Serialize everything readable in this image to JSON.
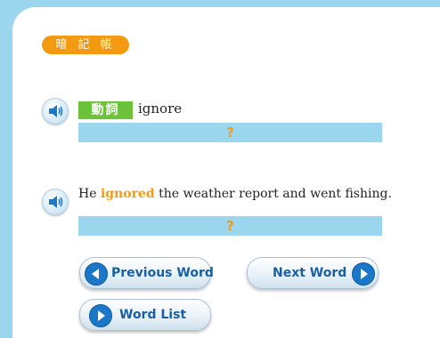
{
  "notebook": {
    "tag_label": "暗 記 帳"
  },
  "vocab": {
    "part_of_speech": "動詞",
    "word": "ignore",
    "answer_placeholder": "?"
  },
  "example": {
    "before": "He ",
    "highlight": "ignored",
    "after": " the weather report and went fishing.",
    "answer_placeholder": "?"
  },
  "buttons": {
    "previous": "Previous Word",
    "next": "Next Word",
    "list": "Word List"
  },
  "colors": {
    "accent_orange": "#f49a12",
    "answer_bar": "#9ad6ee",
    "pos_green": "#6cc33a",
    "button_blue": "#1b78c9"
  }
}
